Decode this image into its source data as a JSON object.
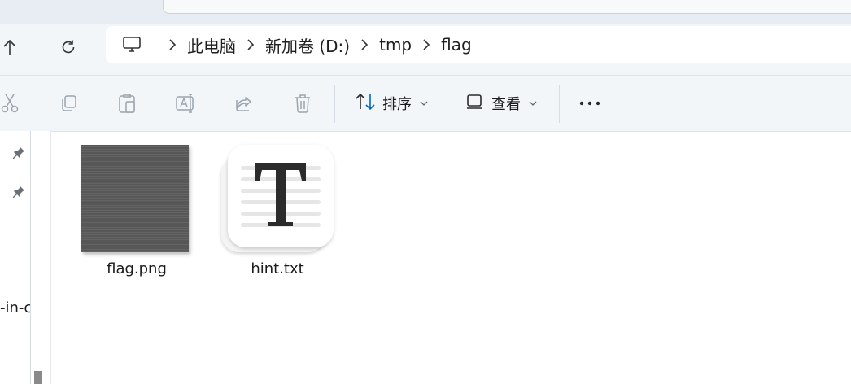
{
  "nav": {
    "up_icon": "arrow-up-icon",
    "refresh_icon": "refresh-icon"
  },
  "breadcrumb": {
    "root_icon": "computer-icon",
    "items": [
      "此电脑",
      "新加卷 (D:)",
      "tmp",
      "flag"
    ]
  },
  "toolbar": {
    "sort_label": "排序",
    "view_label": "查看",
    "icons": [
      "cut-icon",
      "copy-icon",
      "paste-icon",
      "rename-icon",
      "share-icon",
      "delete-icon",
      "sort-icon",
      "view-icon",
      "more-icon"
    ]
  },
  "sidebar": {
    "truncated_text": "-in-c"
  },
  "files": [
    {
      "name": "flag.png",
      "icon": "image-thumbnail"
    },
    {
      "name": "hint.txt",
      "icon": "text-document-icon"
    }
  ],
  "colors": {
    "accent": "#0067c0",
    "chrome": "#f3f6f9",
    "thumbnail_gray": "#5c5c5c"
  }
}
